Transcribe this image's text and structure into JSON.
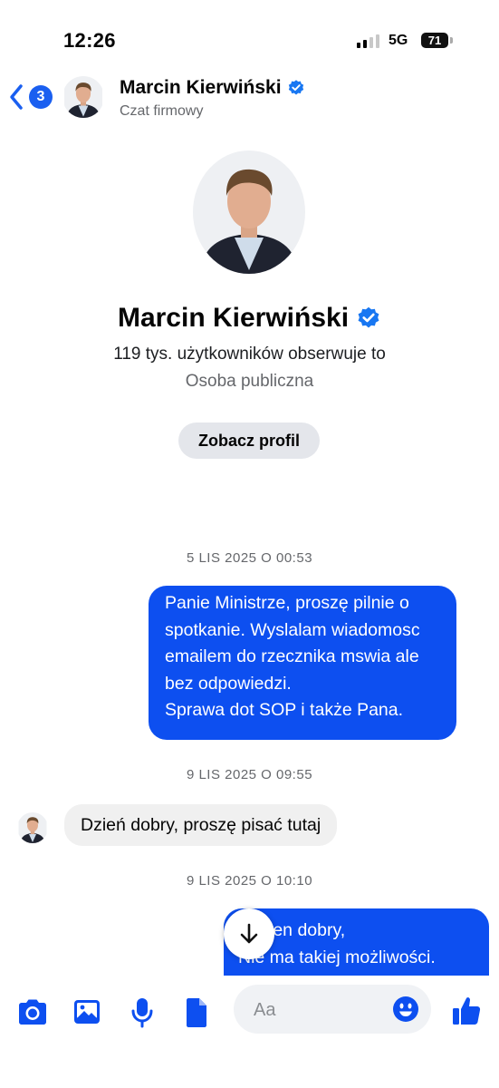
{
  "status_bar": {
    "time": "12:26",
    "network": "5G",
    "battery": "71"
  },
  "header": {
    "back_badge": "3",
    "name": "Marcin Kierwiński",
    "subtitle": "Czat firmowy"
  },
  "profile": {
    "name": "Marcin Kierwiński",
    "followers": "119 tys. użytkowników obserwuje to",
    "category": "Osoba publiczna",
    "view_profile_label": "Zobacz profil"
  },
  "conversation": {
    "timestamp_1": "5 LIS 2025 O 00:53",
    "message_1_lines": [
      "Panie Ministrze, proszę pilnie o",
      "spotkanie. Wyslalam wiadomosc",
      "emailem do rzecznika mswia ale",
      "bez odpowiedzi.",
      "Sprawa dot SOP i także Pana."
    ],
    "timestamp_2": "9 LIS 2025 O 09:55",
    "message_2": "Dzień dobry, proszę pisać tutaj",
    "timestamp_3": "9 LIS 2025 O 10:10",
    "message_3_lines": [
      "ien dobry,",
      "Nie ma takiej możliwości."
    ]
  },
  "composer": {
    "placeholder": "Aa"
  },
  "colors": {
    "accent": "#0d4ff0",
    "badge": "#1a5ff0",
    "verified": "#1877f2"
  },
  "icons": [
    "back-chevron-icon",
    "verified-badge-icon",
    "camera-icon",
    "gallery-icon",
    "microphone-icon",
    "document-icon",
    "emoji-icon",
    "thumbs-up-icon",
    "arrow-down-icon"
  ]
}
